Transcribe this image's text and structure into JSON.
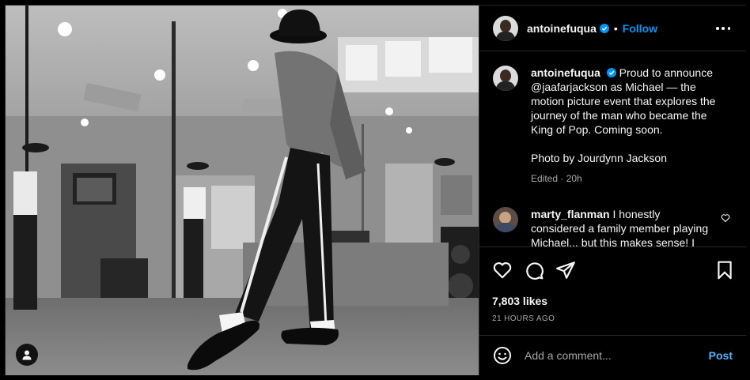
{
  "header": {
    "username": "antoinefuqua",
    "separator": "•",
    "follow_label": "Follow",
    "verified_icon": "verified-badge-icon",
    "more_icon": "more-options-icon"
  },
  "caption": {
    "username": "antoinefuqua",
    "text": "Proud to announce @jaafarjackson as Michael — the motion picture event that explores the journey of the man who became the King of Pop. Coming soon.",
    "credit": "Photo by Jourdynn Jackson",
    "edited": "Edited · 20h"
  },
  "comment": {
    "username": "marty_flanman",
    "text": "I honestly considered a family member playing Michael... but this makes sense! I"
  },
  "actions": {
    "likes": "7,803 likes",
    "time": "21 HOURS AGO",
    "icons": [
      "heart-icon",
      "comment-icon",
      "share-icon",
      "bookmark-icon"
    ]
  },
  "add_comment": {
    "placeholder": "Add a comment...",
    "post_label": "Post",
    "emoji_icon": "emoji-icon"
  },
  "colors": {
    "background": "#000000",
    "text": "#f5f5f5",
    "secondary": "#a8a8a8",
    "link": "#0095f6",
    "post": "#4cb5f9",
    "divider": "#262626"
  }
}
